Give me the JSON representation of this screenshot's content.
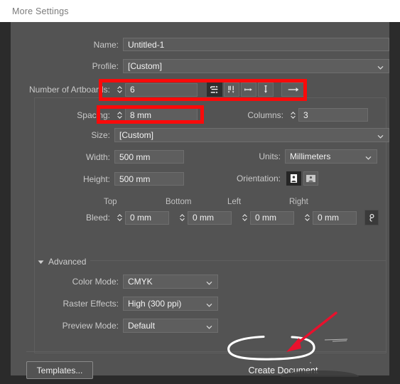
{
  "window": {
    "title": "More Settings"
  },
  "form": {
    "name": {
      "label": "Name:",
      "value": "Untitled-1"
    },
    "profile": {
      "label": "Profile:",
      "value": "[Custom]",
      "icon": "chevron-down-icon"
    },
    "artboards": {
      "label": "Number of Artboards:",
      "value": "6",
      "arrange_buttons": [
        {
          "name": "grid-by-row",
          "state": "selected"
        },
        {
          "name": "grid-by-column",
          "state": "normal"
        },
        {
          "name": "arrange-by-row",
          "state": "normal"
        },
        {
          "name": "arrange-by-column",
          "state": "normal"
        },
        {
          "name": "change-to-right-to-left-layout",
          "state": "normal"
        }
      ]
    },
    "spacing": {
      "label": "Spacing:",
      "value": "8 mm"
    },
    "columns": {
      "label": "Columns:",
      "value": "3"
    },
    "size": {
      "label": "Size:",
      "value": "[Custom]",
      "icon": "chevron-down-icon"
    },
    "width": {
      "label": "Width:",
      "value": "500 mm"
    },
    "height": {
      "label": "Height:",
      "value": "500 mm"
    },
    "units": {
      "label": "Units:",
      "value": "Millimeters",
      "icon": "chevron-down-icon"
    },
    "orientation": {
      "label": "Orientation:",
      "portrait": "portrait-orientation-icon",
      "landscape": "landscape-orientation-icon",
      "selected": "portrait"
    },
    "bleed": {
      "label": "Bleed:",
      "headers": [
        "Top",
        "Bottom",
        "Left",
        "Right"
      ],
      "values": [
        "0 mm",
        "0 mm",
        "0 mm",
        "0 mm"
      ],
      "link_icon": "link-chain-icon"
    },
    "advanced": {
      "label": "Advanced",
      "toggle_icon": "triangle-down-icon",
      "color_mode": {
        "label": "Color Mode:",
        "value": "CMYK"
      },
      "raster_effects": {
        "label": "Raster Effects:",
        "value": "High (300 ppi)"
      },
      "preview_mode": {
        "label": "Preview Mode:",
        "value": "Default"
      }
    }
  },
  "footer": {
    "templates_label": "Templates...",
    "create_label": "Create Document"
  },
  "annotations": {
    "highlight_color": "#fa0a0a",
    "circle_color": "#ffffff",
    "boxes": [
      "number-of-artboards-row",
      "spacing-field"
    ],
    "arrow_target": "create-document-button"
  }
}
